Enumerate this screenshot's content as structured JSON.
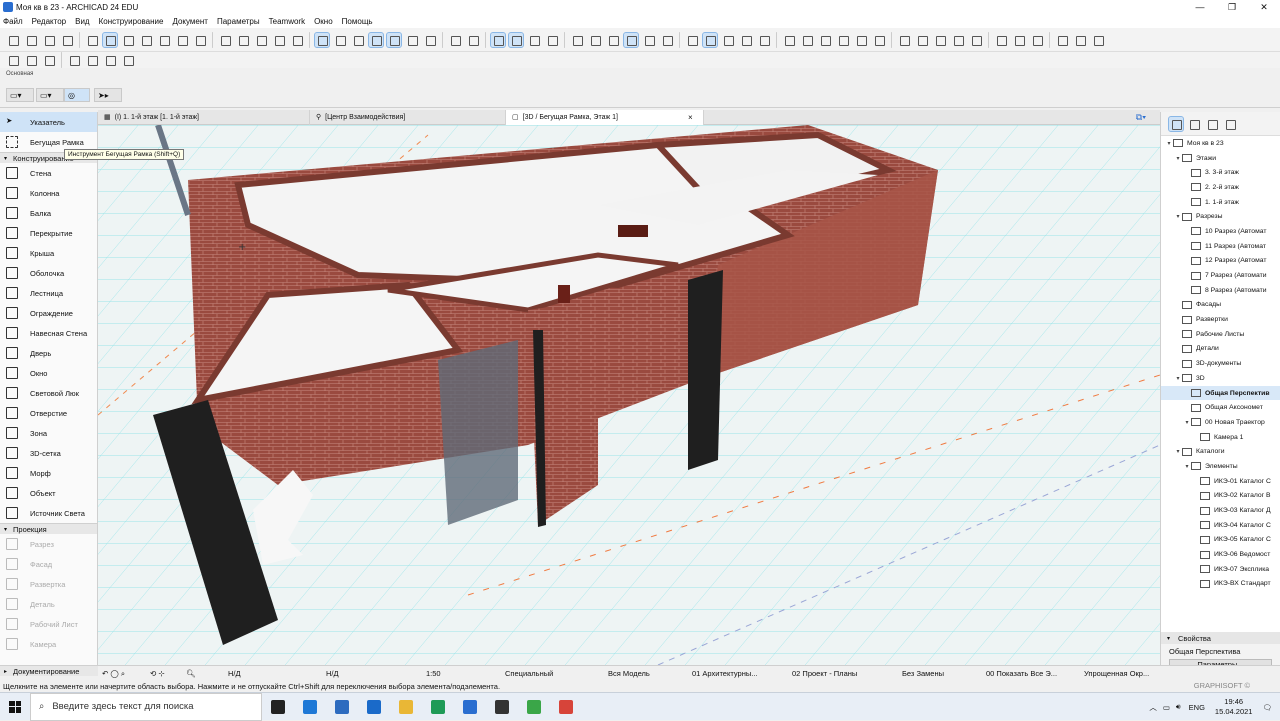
{
  "window": {
    "title": "Моя кв в 23 - ARCHICAD 24 EDU",
    "min": "—",
    "max": "❐",
    "close": "✕"
  },
  "menu": [
    "Файл",
    "Редактор",
    "Вид",
    "Конструирование",
    "Документ",
    "Параметры",
    "Teamwork",
    "Окно",
    "Помощь"
  ],
  "infobox": {
    "label": "Основная"
  },
  "toolbox": {
    "pointer": "Указатель",
    "marquee": "Бегущая Рамка",
    "tooltip": "Инструмент Бегущая Рамка (Shift+Q)",
    "section_design": "Конструирование",
    "design_tools": [
      {
        "label": "Стена",
        "icon": "wall-icon"
      },
      {
        "label": "Колонна",
        "icon": "column-icon"
      },
      {
        "label": "Балка",
        "icon": "beam-icon"
      },
      {
        "label": "Перекрытие",
        "icon": "slab-icon"
      },
      {
        "label": "Крыша",
        "icon": "roof-icon"
      },
      {
        "label": "Оболочка",
        "icon": "shell-icon"
      },
      {
        "label": "Лестница",
        "icon": "stair-icon"
      },
      {
        "label": "Ограждение",
        "icon": "railing-icon"
      },
      {
        "label": "Навесная Стена",
        "icon": "curtain-wall-icon"
      },
      {
        "label": "Дверь",
        "icon": "door-icon"
      },
      {
        "label": "Окно",
        "icon": "window-icon"
      },
      {
        "label": "Световой Люк",
        "icon": "skylight-icon"
      },
      {
        "label": "Отверстие",
        "icon": "opening-icon"
      },
      {
        "label": "Зона",
        "icon": "zone-icon"
      },
      {
        "label": "3D-сетка",
        "icon": "mesh-icon"
      },
      {
        "label": "Морф",
        "icon": "morph-icon"
      },
      {
        "label": "Объект",
        "icon": "object-icon"
      },
      {
        "label": "Источник Света",
        "icon": "lamp-icon"
      }
    ],
    "section_view": "Проекция",
    "view_tools": [
      "Разрез",
      "Фасад",
      "Развертка",
      "Деталь",
      "Рабочий Лист",
      "Камера"
    ],
    "section_doc": "Документирование"
  },
  "tabs": [
    {
      "label": "(I) 1. 1-й этаж [1. 1-й этаж]"
    },
    {
      "label": "[Центр Взаимодействия]"
    },
    {
      "label": "[3D / Бегущая Рамка, Этаж 1]",
      "close": "×"
    }
  ],
  "navigator": {
    "items": [
      {
        "label": "Моя кв в 23",
        "tw": "▾",
        "indent": 0
      },
      {
        "label": "Этажи",
        "tw": "▾",
        "indent": 1
      },
      {
        "label": "3. 3-й этаж",
        "tw": "",
        "indent": 2
      },
      {
        "label": "2. 2-й этаж",
        "tw": "",
        "indent": 2
      },
      {
        "label": "1. 1-й этаж",
        "tw": "",
        "indent": 2
      },
      {
        "label": "Разрезы",
        "tw": "▾",
        "indent": 1
      },
      {
        "label": "10 Разрез (Автомат",
        "tw": "",
        "indent": 2
      },
      {
        "label": "11 Разрез (Автомат",
        "tw": "",
        "indent": 2
      },
      {
        "label": "12 Разрез (Автомат",
        "tw": "",
        "indent": 2
      },
      {
        "label": "7 Разрез (Автомати",
        "tw": "",
        "indent": 2
      },
      {
        "label": "8 Разрез (Автомати",
        "tw": "",
        "indent": 2
      },
      {
        "label": "Фасады",
        "tw": "",
        "indent": 1
      },
      {
        "label": "Развертки",
        "tw": "",
        "indent": 1
      },
      {
        "label": "Рабочие Листы",
        "tw": "",
        "indent": 1
      },
      {
        "label": "Детали",
        "tw": "",
        "indent": 1
      },
      {
        "label": "3D-документы",
        "tw": "",
        "indent": 1
      },
      {
        "label": "3D",
        "tw": "▾",
        "indent": 1
      },
      {
        "label": "Общая Перспектив",
        "tw": "",
        "indent": 2,
        "selected": true
      },
      {
        "label": "Общая Аксономет",
        "tw": "",
        "indent": 2
      },
      {
        "label": "00 Новая Траектор",
        "tw": "▾",
        "indent": 2
      },
      {
        "label": "Камера 1",
        "tw": "",
        "indent": 3
      },
      {
        "label": "Каталоги",
        "tw": "▾",
        "indent": 1
      },
      {
        "label": "Элементы",
        "tw": "▾",
        "indent": 2
      },
      {
        "label": "ИКЭ-01 Каталог С",
        "tw": "",
        "indent": 3
      },
      {
        "label": "ИКЭ-02 Каталог В",
        "tw": "",
        "indent": 3
      },
      {
        "label": "ИКЭ-03 Каталог Д",
        "tw": "",
        "indent": 3
      },
      {
        "label": "ИКЭ-04 Каталог С",
        "tw": "",
        "indent": 3
      },
      {
        "label": "ИКЭ-05 Каталог С",
        "tw": "",
        "indent": 3
      },
      {
        "label": "ИКЭ-06 Ведомост",
        "tw": "",
        "indent": 3
      },
      {
        "label": "ИКЭ-07 Экспликa",
        "tw": "",
        "indent": 3
      },
      {
        "label": "ИКЭ-ВХ Стандарт",
        "tw": "",
        "indent": 3
      }
    ]
  },
  "properties": {
    "header": "Свойства",
    "value": "Общая Перспектива",
    "button": "Параметры..."
  },
  "quick_options": {
    "nd1": "Н/Д",
    "nd2": "Н/Д",
    "scale": "1:50",
    "mvo": "Специальный",
    "model": "Вся Модель",
    "layers": "01 Архитектурны...",
    "pen": "02 Проект - Планы",
    "override": "Без Замены",
    "renovation": "00 Показать Все Э...",
    "structure": "Упрощенная Окр..."
  },
  "status": {
    "text": "Щелкните на элементе или начертите область выбора. Нажмите и не отпускайте Ctrl+Shift для переключения выбора элемента/подэлемента.",
    "brand": "GRAPHISOFT ©"
  },
  "taskbar": {
    "search_placeholder": "Введите здесь текст для поиска",
    "lang": "ENG",
    "time": "19:46",
    "date": "15.04.2021",
    "apps": [
      {
        "name": "task-view-icon",
        "color": "#222"
      },
      {
        "name": "edge-icon",
        "color": "#1e78d6"
      },
      {
        "name": "store-icon",
        "color": "#2d6bbf"
      },
      {
        "name": "mail-icon",
        "color": "#1a6ac9"
      },
      {
        "name": "explorer-icon",
        "color": "#e9b736"
      },
      {
        "name": "archicad-green-icon",
        "color": "#1e9a57"
      },
      {
        "name": "archicad-icon",
        "color": "#2a6ed0"
      },
      {
        "name": "clock-app-icon",
        "color": "#333"
      },
      {
        "name": "media-icon",
        "color": "#3aa648"
      },
      {
        "name": "chrome-icon",
        "color": "#d7443a"
      }
    ]
  }
}
